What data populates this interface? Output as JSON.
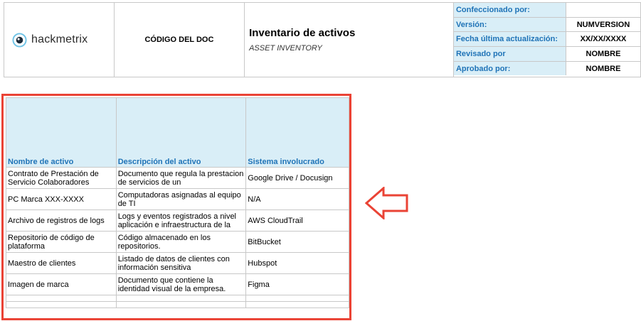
{
  "header": {
    "brand": "hackmetrix",
    "doc_code": "CÓDIGO DEL DOC",
    "title": "Inventario de activos",
    "subtitle": "ASSET INVENTORY",
    "meta": [
      {
        "label": "Confeccionado por:",
        "value": ""
      },
      {
        "label": "Versión:",
        "value": "NUMVERSION"
      },
      {
        "label": "Fecha última actualización:",
        "value": "XX/XX/XXXX"
      },
      {
        "label": "Revisado por",
        "value": "NOMBRE"
      },
      {
        "label": "Aprobado por:",
        "value": "NOMBRE"
      }
    ]
  },
  "assets": {
    "columns": [
      "Nombre de activo",
      "Descripción del activo",
      "Sistema involucrado"
    ],
    "rows": [
      [
        "Contrato de Prestación de Servicio Colaboradores",
        "Documento que regula la prestacion de servicios de un",
        "Google Drive / Docusign"
      ],
      [
        "PC Marca XXX-XXXX",
        "Computadoras asignadas al equipo de TI",
        "N/A"
      ],
      [
        "Archivo de registros de logs",
        "Logs y eventos registrados a nivel aplicación e infraestructura de la",
        "AWS CloudTrail"
      ],
      [
        "Repositorio de código de plataforma",
        "Código almacenado en los repositorios.",
        "BitBucket"
      ],
      [
        "Maestro de clientes",
        "Listado de datos de clientes con información sensitiva",
        "Hubspot"
      ],
      [
        "Imagen de marca",
        "Documento que contiene la identidad visual de la empresa.",
        "Figma"
      ]
    ]
  },
  "colors": {
    "accent": "#1f73b7",
    "header_fill": "#d9eef7",
    "highlight": "#ea4335"
  },
  "icons": {
    "logo": "hackmetrix-eye-logo",
    "pointer": "left-arrow-outline"
  }
}
